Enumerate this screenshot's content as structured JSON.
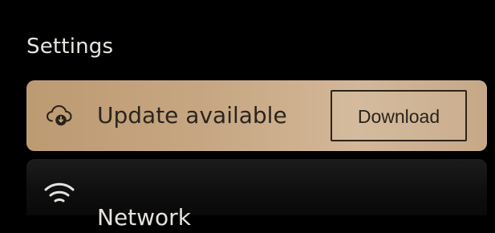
{
  "header": {
    "title": "Settings"
  },
  "rows": [
    {
      "icon": "cloud-download-icon",
      "label": "Update available",
      "action_label": "Download"
    },
    {
      "icon": "wifi-icon",
      "label": "Network"
    }
  ],
  "colors": {
    "background": "#000000",
    "highlight_row": "#c7a783",
    "text_dark": "#2b241d",
    "text_light": "#e9e6e2"
  }
}
